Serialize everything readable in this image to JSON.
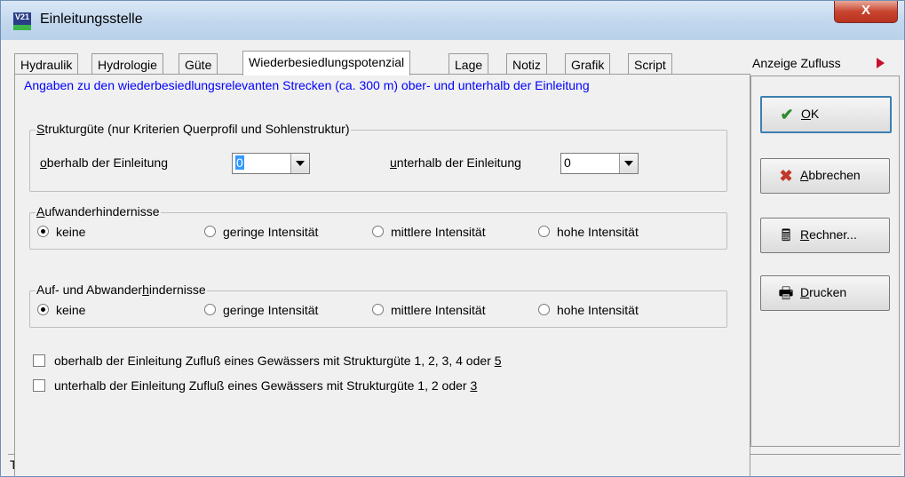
{
  "window": {
    "title": "Einleitungsstelle",
    "icon_text": "V21",
    "close_label": "X"
  },
  "tabs": [
    {
      "label": "Hydraulik"
    },
    {
      "label": "Hydrologie"
    },
    {
      "label": "Güte"
    },
    {
      "label": "Wiederbesiedlungspotenzial",
      "active": true
    },
    {
      "label": "Lage"
    },
    {
      "label": "Notiz"
    },
    {
      "label": "Grafik"
    },
    {
      "label": "Script"
    }
  ],
  "side": {
    "header": "Anzeige Zufluss",
    "buttons": [
      {
        "label_u": "O",
        "label_rest": "K",
        "icon": "check-icon"
      },
      {
        "label_u": "A",
        "label_rest": "bbrechen",
        "icon": "cross-icon"
      },
      {
        "label_u": "R",
        "label_rest": "echner...",
        "icon": "calculator-icon"
      },
      {
        "label_u": "D",
        "label_rest": "rucken",
        "icon": "printer-icon"
      }
    ]
  },
  "info_text": "Angaben zu den wiederbesiedlungsrelevanten Strecken (ca. 300 m) ober- und unterhalb der Einleitung",
  "struktur": {
    "legend_u": "S",
    "legend_rest": "trukturgüte (nur Kriterien Querprofil und Sohlenstruktur)",
    "oberhalb_u": "o",
    "oberhalb_rest": "berhalb der Einleitung",
    "oberhalb_value": "0",
    "unterhalb_u": "u",
    "unterhalb_rest": "nterhalb der Einleitung",
    "unterhalb_value": "0"
  },
  "aufwander": {
    "legend_u": "A",
    "legend_rest": "ufwanderhindernisse",
    "options": [
      "keine",
      "geringe Intensität",
      "mittlere Intensität",
      "hohe Intensität"
    ],
    "selected": 0
  },
  "aufab": {
    "legend_pre": "Auf- und Abwander",
    "legend_u": "h",
    "legend_rest": "indernisse",
    "options": [
      "keine",
      "geringe Intensität",
      "mittlere Intensität",
      "hohe Intensität"
    ],
    "selected": 0
  },
  "checks": [
    {
      "text": "oberhalb der Einleitung Zufluß eines Gewässers mit Strukturgüte 1, 2, 3, 4 oder ",
      "u": "5",
      "checked": false
    },
    {
      "text": "unterhalb der Einleitung Zufluß eines Gewässers mit Strukturgüte 1, 2 oder ",
      "u": "3",
      "checked": false
    }
  ],
  "statusbar": {
    "text": "TextFeld"
  }
}
